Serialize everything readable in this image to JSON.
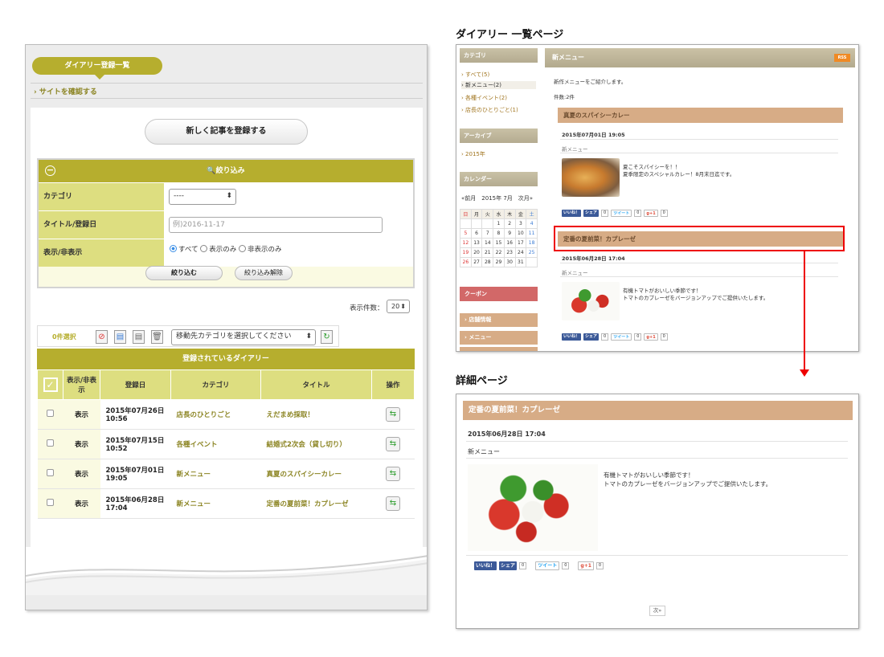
{
  "admin": {
    "tab_title": "ダイアリー登録一覧",
    "site_link": "サイトを確認する",
    "new_button": "新しく記事を登録する",
    "filter": {
      "header": "絞り込み",
      "category_label": "カテゴリ",
      "category_value": "----",
      "title_label": "タイトル/登録日",
      "title_placeholder": "例)2016-11-17",
      "visibility_label": "表示/非表示",
      "radio_all": "すべて",
      "radio_shown": "表示のみ",
      "radio_hidden": "非表示のみ",
      "apply_button": "絞り込む",
      "clear_button": "絞り込み解除"
    },
    "display_count_label": "表示件数：",
    "display_count_value": "20",
    "selected_count": "0件選択",
    "move_category_placeholder": "移動先カテゴリを選択してください",
    "table": {
      "caption": "登録されているダイアリー",
      "columns": [
        "表示/非表示",
        "登録日",
        "カテゴリ",
        "タイトル",
        "操作"
      ],
      "rows": [
        {
          "visibility": "表示",
          "date": "2015年07月26日",
          "time": "10:56",
          "category": "店長のひとりごと",
          "title": "えだまめ採取！"
        },
        {
          "visibility": "表示",
          "date": "2015年07月15日",
          "time": "10:52",
          "category": "各種イベント",
          "title": "結婚式2次会（貸し切り）"
        },
        {
          "visibility": "表示",
          "date": "2015年07月01日",
          "time": "19:05",
          "category": "新メニュー",
          "title": "真夏のスパイシーカレー"
        },
        {
          "visibility": "表示",
          "date": "2015年06月28日",
          "time": "17:04",
          "category": "新メニュー",
          "title": "定番の夏前菜！カプレーゼ"
        }
      ]
    }
  },
  "list_page": {
    "caption": "ダイアリー 一覧ページ",
    "sidebar": {
      "category_header": "カテゴリ",
      "categories": [
        "すべて(5)",
        "新メニュー(2)",
        "各種イベント(2)",
        "店長のひとりごと(1)"
      ],
      "archive_header": "アーカイブ",
      "archive_item": "2015年",
      "calendar_header": "カレンダー",
      "calendar_nav": "«前月　2015年 7月　次月»",
      "weekdays": [
        "日",
        "月",
        "火",
        "水",
        "木",
        "金",
        "土"
      ],
      "weeks": [
        [
          "",
          "",
          "",
          "1",
          "2",
          "3",
          "4"
        ],
        [
          "5",
          "6",
          "7",
          "8",
          "9",
          "10",
          "11"
        ],
        [
          "12",
          "13",
          "14",
          "15",
          "16",
          "17",
          "18"
        ],
        [
          "19",
          "20",
          "21",
          "22",
          "23",
          "24",
          "25"
        ],
        [
          "26",
          "27",
          "28",
          "29",
          "30",
          "31",
          ""
        ]
      ],
      "coupon": "クーポン",
      "shop_info": "店舗情報",
      "menu": "メニュー"
    },
    "main": {
      "header": "新メニュー",
      "rss": "RSS",
      "intro": "新作メニューをご紹介します。",
      "count": "件数:2件",
      "posts": [
        {
          "title": "真夏のスパイシーカレー",
          "date": "2015年07月01日 19:05",
          "category": "新メニュー",
          "text1": "夏こそスパイシーを！！",
          "text2": "夏季限定のスペシャルカレー！8月末日迄です。"
        },
        {
          "title": "定番の夏前菜！カプレーゼ",
          "date": "2015年06月28日 17:04",
          "category": "新メニュー",
          "text1": "有機トマトがおいしい季節です！",
          "text2": "トマトのカプレーゼをバージョンアップでご提供いたします。"
        }
      ],
      "social": {
        "like": "いいね！",
        "share": "シェア",
        "tweet": "ツイート",
        "gplus": "g+1",
        "zero": "0"
      }
    }
  },
  "detail_page": {
    "caption": "詳細ページ",
    "title": "定番の夏前菜！カプレーゼ",
    "date": "2015年06月28日 17:04",
    "category": "新メニュー",
    "text1": "有機トマトがおいしい季節です！",
    "text2": "トマトのカプレーゼをバージョンアップでご提供いたします。",
    "next": "次»"
  }
}
